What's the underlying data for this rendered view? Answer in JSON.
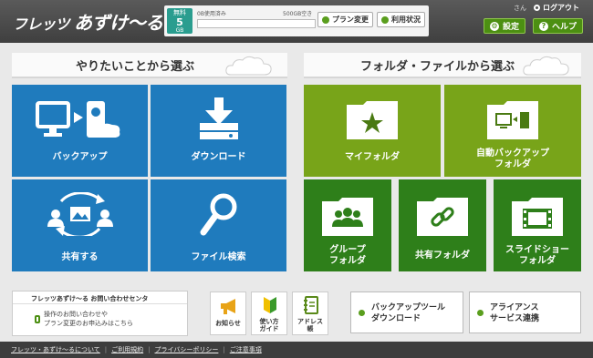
{
  "header": {
    "logo_small": "フレッツ",
    "logo_big": "あずけ〜る",
    "free_label": "無料",
    "free_size": "5",
    "free_unit": "GB",
    "usage_label": "0B使用済み",
    "free_space_label": "500GB空き",
    "usage_fraction": 0,
    "plan_change": "プラン変更",
    "usage_status": "利用状況",
    "user_suffix": "さん",
    "logout": "ログアウト",
    "settings": "設定",
    "help": "ヘルプ"
  },
  "left_section": {
    "title": "やりたいことから選ぶ",
    "tiles": [
      {
        "label": "バックアップ"
      },
      {
        "label": "ダウンロード"
      },
      {
        "label": "共有する"
      },
      {
        "label": "ファイル検索"
      }
    ]
  },
  "right_section": {
    "title": "フォルダ・ファイルから選ぶ",
    "tiles": [
      {
        "label": "マイフォルダ"
      },
      {
        "label_line1": "自動バックアップ",
        "label_line2": "フォルダ"
      },
      {
        "label_line1": "グループ",
        "label_line2": "フォルダ"
      },
      {
        "label": "共有フォルダ"
      },
      {
        "label_line1": "スライドショー",
        "label_line2": "フォルダ"
      }
    ]
  },
  "contact": {
    "title": "フレッツあずけ〜る お問い合わせセンタ",
    "line1": "操作のお問い合わせや",
    "line2": "プラン変更のお申込みはこちら"
  },
  "icon_buttons": [
    {
      "line1": "お知らせ",
      "line2": ""
    },
    {
      "line1": "使い方",
      "line2": "ガイド"
    },
    {
      "line1": "アドレス",
      "line2": "帳"
    }
  ],
  "link_buttons": [
    {
      "line1": "バックアップツール",
      "line2": "ダウンロード"
    },
    {
      "line1": "アライアンス",
      "line2": "サービス連携"
    }
  ],
  "footer": {
    "links": [
      "フレッツ・あずけ〜るについて",
      "ご利用規約",
      "プライバシーポリシー",
      "ご注意事項"
    ]
  },
  "colors": {
    "blue_tile": "#1f7bbd",
    "olive_tile": "#78a419",
    "dark_green_tile": "#2e7f1a",
    "header_bg": "#4a4a4a"
  }
}
